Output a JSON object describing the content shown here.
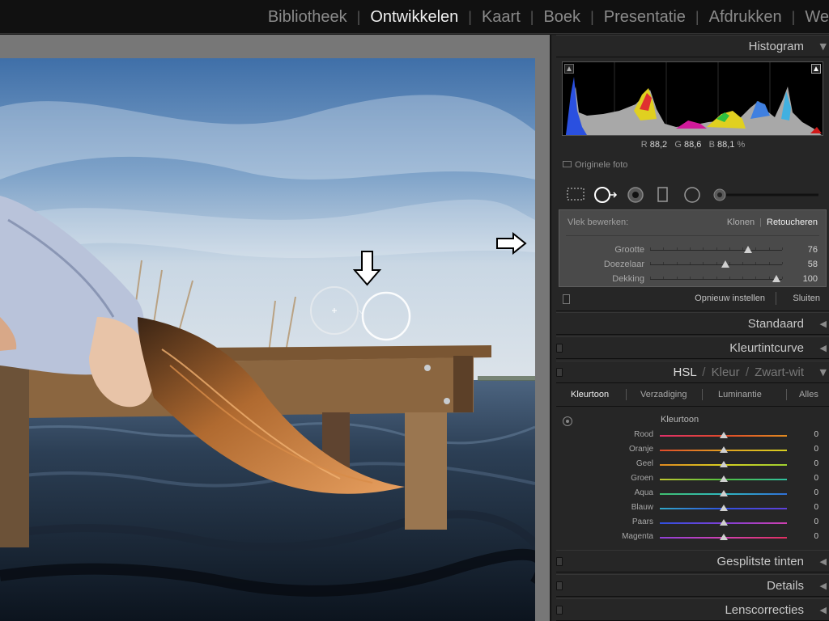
{
  "modules": {
    "items": [
      {
        "label": "Bibliotheek",
        "active": false
      },
      {
        "label": "Ontwikkelen",
        "active": true
      },
      {
        "label": "Kaart",
        "active": false
      },
      {
        "label": "Boek",
        "active": false
      },
      {
        "label": "Presentatie",
        "active": false
      },
      {
        "label": "Afdrukken",
        "active": false
      },
      {
        "label": "We",
        "active": false
      }
    ]
  },
  "histogram": {
    "title": "Histogram",
    "readout": {
      "r_label": "R",
      "r_value": "88,2",
      "g_label": "G",
      "g_value": "88,6",
      "b_label": "B",
      "b_value": "88,1",
      "unit": "%"
    },
    "original_photo_label": "Originele foto"
  },
  "spot_removal": {
    "label": "Vlek bewerken:",
    "mode_clone": "Klonen",
    "mode_heal": "Retoucheren",
    "active_mode": "Retoucheren",
    "sliders": [
      {
        "label": "Grootte",
        "value": "76",
        "level": 0.74
      },
      {
        "label": "Doezelaar",
        "value": "58",
        "level": 0.57
      },
      {
        "label": "Dekking",
        "value": "100",
        "level": 0.96
      }
    ],
    "reset_label": "Opnieuw instellen",
    "close_label": "Sluiten"
  },
  "panels": {
    "standaard": "Standaard",
    "tone_curve": "Kleurtintcurve",
    "hsl": "HSL",
    "hsl_sep": "/",
    "color": "Kleur",
    "bw": "Zwart-wit",
    "split_toning": "Gesplitste tinten",
    "details": "Details",
    "lens": "Lenscorrecties"
  },
  "hsl": {
    "tabs": [
      {
        "label": "Kleurtoon",
        "active": true
      },
      {
        "label": "Verzadiging",
        "active": false
      },
      {
        "label": "Luminantie",
        "active": false
      },
      {
        "label": "Alles",
        "active": false
      }
    ],
    "section_title": "Kleurtoon",
    "rows": [
      {
        "label": "Rood",
        "value": "0",
        "grad": [
          "#e0306a",
          "#e04a2a",
          "#e08a20"
        ]
      },
      {
        "label": "Oranje",
        "value": "0",
        "grad": [
          "#e04a2a",
          "#e0a020",
          "#d8d020"
        ]
      },
      {
        "label": "Geel",
        "value": "0",
        "grad": [
          "#e08a20",
          "#d8d020",
          "#a0d030"
        ]
      },
      {
        "label": "Groen",
        "value": "0",
        "grad": [
          "#c0c830",
          "#50c040",
          "#30c0a0"
        ]
      },
      {
        "label": "Aqua",
        "value": "0",
        "grad": [
          "#40c070",
          "#30b8c0",
          "#3070d8"
        ]
      },
      {
        "label": "Blauw",
        "value": "0",
        "grad": [
          "#30a8c8",
          "#3050e0",
          "#6040d8"
        ]
      },
      {
        "label": "Paars",
        "value": "0",
        "grad": [
          "#3050e0",
          "#8040d8",
          "#d040b0"
        ]
      },
      {
        "label": "Magenta",
        "value": "0",
        "grad": [
          "#9040d8",
          "#d040b0",
          "#e03060"
        ]
      }
    ]
  },
  "colors": {
    "panel_bg": "#262626",
    "active_text": "#f0f0f0",
    "inactive_text": "#8a8a8a"
  }
}
